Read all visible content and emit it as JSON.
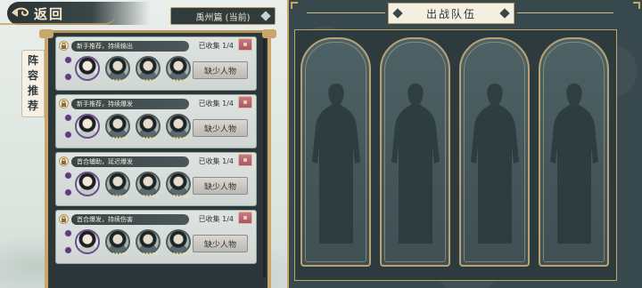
{
  "back": {
    "label": "返回"
  },
  "chapter": {
    "label": "禹州篇 (当前)"
  },
  "side_tab": {
    "chars": [
      "阵",
      "容",
      "推",
      "荐"
    ]
  },
  "lineups": [
    {
      "title": "新手推荐，持续输出",
      "collected": "已收集 1/4",
      "button": "缺少人物"
    },
    {
      "title": "新手推荐，持续爆发",
      "collected": "已收集 1/4",
      "button": "缺少人物"
    },
    {
      "title": "首合辅助，延迟爆发",
      "collected": "已收集 1/4",
      "button": "缺少人物"
    },
    {
      "title": "首合爆发，持续伤害",
      "collected": "已收集 1/4",
      "button": "缺少人物"
    }
  ],
  "team": {
    "title": "出战队伍",
    "slots": 4
  },
  "icons": {
    "back": "back-arrow-swirl-icon",
    "chapter": "diamond-dropdown-icon",
    "lock": "lock-icon",
    "chest": "treasure-chest-icon",
    "rank": "rank-badge-icon",
    "slot": "empty-hero-silhouette"
  },
  "colors": {
    "gold_trim": "#c9a66b",
    "panel_dark": "#2c3739",
    "card_light": "#dfe4e1",
    "slot_teal": "#4d6266",
    "text_light": "#f3ead2"
  }
}
